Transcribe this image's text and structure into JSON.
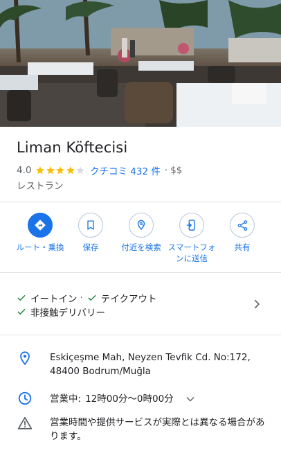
{
  "place": {
    "name": "Liman Köftecisi",
    "rating": "4.0",
    "stars_filled": 4,
    "stars_total": 5,
    "reviews_label": "クチコミ 432 件",
    "separator": "·",
    "price": "$$",
    "category": "レストラン"
  },
  "actions": [
    {
      "label": "ルート・乗換",
      "icon": "directions-icon"
    },
    {
      "label": "保存",
      "icon": "bookmark-icon"
    },
    {
      "label": "付近を検索",
      "icon": "nearby-search-icon"
    },
    {
      "label": "スマートフォンに送信",
      "icon": "send-to-phone-icon"
    },
    {
      "label": "共有",
      "icon": "share-icon"
    }
  ],
  "services": {
    "line1": [
      "イートイン",
      "テイクアウト"
    ],
    "sep": "·",
    "line2": [
      "非接触デリバリー"
    ]
  },
  "info": {
    "address": "Eskiçeşme Mah, Neyzen Tevfik Cd. No:172, 48400 Bodrum/Muğla",
    "hours_label": "営業中:",
    "hours_value": "12時00分〜0時00分",
    "notice": "営業時間や提供サービスが実際とは異なる場合があります。"
  },
  "colors": {
    "accent": "#1a73e8",
    "star": "#fbbc04",
    "check": "#188038",
    "text": "#202124"
  }
}
